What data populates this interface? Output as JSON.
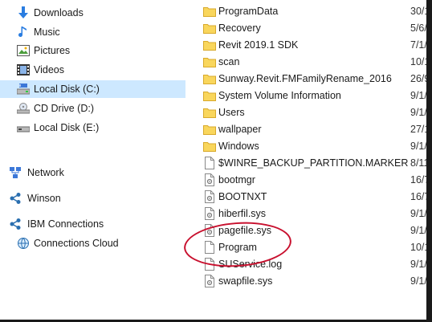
{
  "nav": {
    "items": [
      {
        "label": "Downloads",
        "icon": "downloads-icon",
        "selected": false
      },
      {
        "label": "Music",
        "icon": "music-icon",
        "selected": false
      },
      {
        "label": "Pictures",
        "icon": "pictures-icon",
        "selected": false
      },
      {
        "label": "Videos",
        "icon": "videos-icon",
        "selected": false
      },
      {
        "label": "Local Disk (C:)",
        "icon": "local-disk-icon",
        "selected": true
      },
      {
        "label": "CD Drive (D:)",
        "icon": "cd-drive-icon",
        "selected": false
      },
      {
        "label": "Local Disk (E:)",
        "icon": "removable-disk-icon",
        "selected": false
      },
      {
        "label": "Network",
        "icon": "network-icon",
        "selected": false
      },
      {
        "label": "Winson",
        "icon": "share-icon",
        "selected": false
      },
      {
        "label": "IBM Connections",
        "icon": "share-icon",
        "selected": false
      },
      {
        "label": "Connections Cloud",
        "icon": "cloud-globe-icon",
        "selected": false
      }
    ]
  },
  "files": [
    {
      "name": "ProgramData",
      "type": "folder",
      "date": "30/1"
    },
    {
      "name": "Recovery",
      "type": "folder",
      "date": "5/6/2"
    },
    {
      "name": "Revit 2019.1 SDK",
      "type": "folder",
      "date": "7/1/2"
    },
    {
      "name": "scan",
      "type": "folder",
      "date": "10/1"
    },
    {
      "name": "Sunway.Revit.FMFamilyRename_2016",
      "type": "folder",
      "date": "26/9"
    },
    {
      "name": "System Volume Information",
      "type": "folder",
      "date": "9/1/"
    },
    {
      "name": "Users",
      "type": "folder",
      "date": "9/1/"
    },
    {
      "name": "wallpaper",
      "type": "folder",
      "date": "27/1"
    },
    {
      "name": "Windows",
      "type": "folder",
      "date": "9/1/"
    },
    {
      "name": "$WINRE_BACKUP_PARTITION.MARKER",
      "type": "file",
      "date": "8/11"
    },
    {
      "name": "bootmgr",
      "type": "sysfile",
      "date": "16/7"
    },
    {
      "name": "BOOTNXT",
      "type": "sysfile",
      "date": "16/7"
    },
    {
      "name": "hiberfil.sys",
      "type": "sysfile",
      "date": "9/1/"
    },
    {
      "name": "pagefile.sys",
      "type": "sysfile",
      "date": "9/1/"
    },
    {
      "name": "Program",
      "type": "file",
      "date": "10/1"
    },
    {
      "name": "SUService.log",
      "type": "file",
      "date": "9/1/"
    },
    {
      "name": "swapfile.sys",
      "type": "sysfile",
      "date": "9/1/"
    }
  ],
  "colors": {
    "folder": "#f9d65c",
    "selection": "#cde8ff",
    "highlight": "#c8102e"
  }
}
